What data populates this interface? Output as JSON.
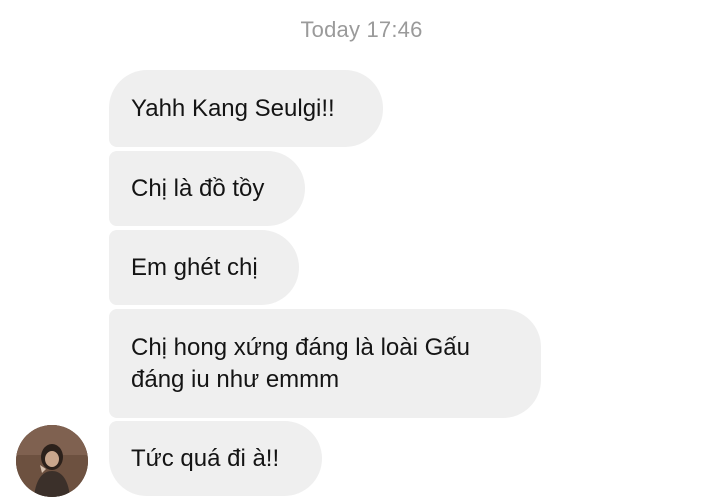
{
  "chat": {
    "timestamp": "Today 17:46",
    "messages": [
      "Yahh Kang Seulgi!!",
      "Chị là đồ tồy",
      "Em ghét chị",
      "Chị hong xứng đáng là loài Gấu đáng iu như emmm",
      "Tức quá đi à!!"
    ],
    "sender_avatar_icon": "avatar-photo"
  }
}
